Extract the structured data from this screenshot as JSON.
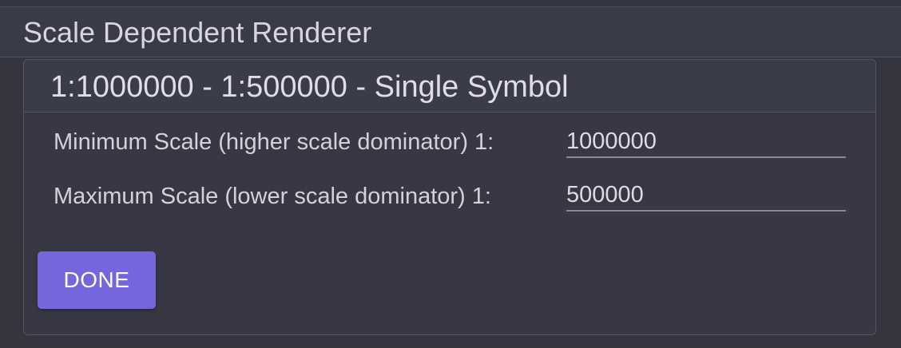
{
  "panel": {
    "title": "Scale Dependent Renderer"
  },
  "renderer": {
    "title": "1:1000000 - 1:500000 - Single Symbol",
    "fields": [
      {
        "label": "Minimum Scale (higher scale dominator) 1:",
        "value": "1000000"
      },
      {
        "label": "Maximum Scale (lower scale dominator) 1:",
        "value": "500000"
      }
    ],
    "done_label": "DONE"
  },
  "colors": {
    "background": "#34353f",
    "accent": "#7467dd"
  }
}
